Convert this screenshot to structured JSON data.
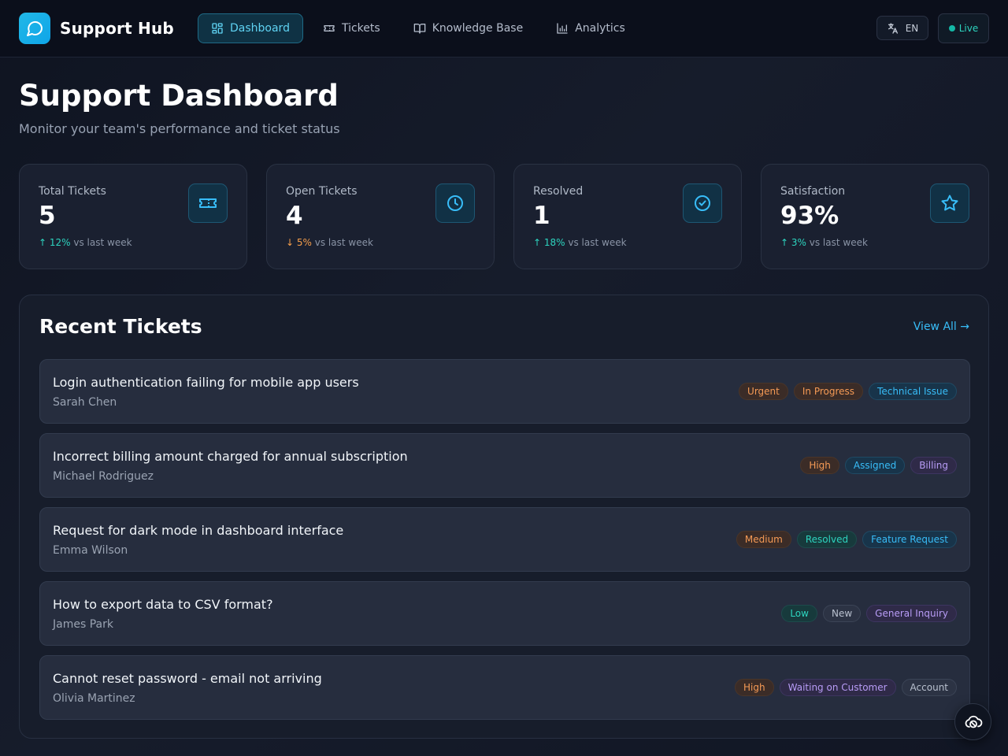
{
  "app": {
    "name": "Support Hub",
    "icon": "chat-bubble-icon"
  },
  "nav": {
    "items": [
      {
        "label": "Dashboard",
        "icon": "grid-icon",
        "active": true
      },
      {
        "label": "Tickets",
        "icon": "ticket-icon",
        "active": false
      },
      {
        "label": "Knowledge Base",
        "icon": "book-icon",
        "active": false
      },
      {
        "label": "Analytics",
        "icon": "bar-chart-icon",
        "active": false
      }
    ]
  },
  "header_controls": {
    "language": "EN",
    "language_icon": "translate-icon",
    "status": "Live"
  },
  "page": {
    "title": "Support Dashboard",
    "subtitle": "Monitor your team's performance and ticket status"
  },
  "stats": [
    {
      "label": "Total Tickets",
      "value": "5",
      "arrow": "↑",
      "change": "12%",
      "trend": "up",
      "suffix": "vs last week",
      "icon": "ticket-icon"
    },
    {
      "label": "Open Tickets",
      "value": "4",
      "arrow": "↓",
      "change": "5%",
      "trend": "down",
      "suffix": "vs last week",
      "icon": "clock-icon"
    },
    {
      "label": "Resolved",
      "value": "1",
      "arrow": "↑",
      "change": "18%",
      "trend": "up",
      "suffix": "vs last week",
      "icon": "check-circle-icon"
    },
    {
      "label": "Satisfaction",
      "value": "93%",
      "arrow": "↑",
      "change": "3%",
      "trend": "up",
      "suffix": "vs last week",
      "icon": "star-icon"
    }
  ],
  "recent": {
    "title": "Recent Tickets",
    "view_all": "View All →",
    "tickets": [
      {
        "title": "Login authentication failing for mobile app users",
        "author": "Sarah Chen",
        "priority": "Urgent",
        "status": "In Progress",
        "category": "Technical Issue"
      },
      {
        "title": "Incorrect billing amount charged for annual subscription",
        "author": "Michael Rodriguez",
        "priority": "High",
        "status": "Assigned",
        "category": "Billing"
      },
      {
        "title": "Request for dark mode in dashboard interface",
        "author": "Emma Wilson",
        "priority": "Medium",
        "status": "Resolved",
        "category": "Feature Request"
      },
      {
        "title": "How to export data to CSV format?",
        "author": "James Park",
        "priority": "Low",
        "status": "New",
        "category": "General Inquiry"
      },
      {
        "title": "Cannot reset password - email not arriving",
        "author": "Olivia Martinez",
        "priority": "High",
        "status": "Waiting on Customer",
        "category": "Account"
      }
    ]
  },
  "floating_button": {
    "icon": "cloud-off-icon"
  },
  "colors": {
    "accent": "#38bdf8",
    "brand": "#22b8e6",
    "up": "#2dd4bf",
    "down": "#f59e4b"
  }
}
